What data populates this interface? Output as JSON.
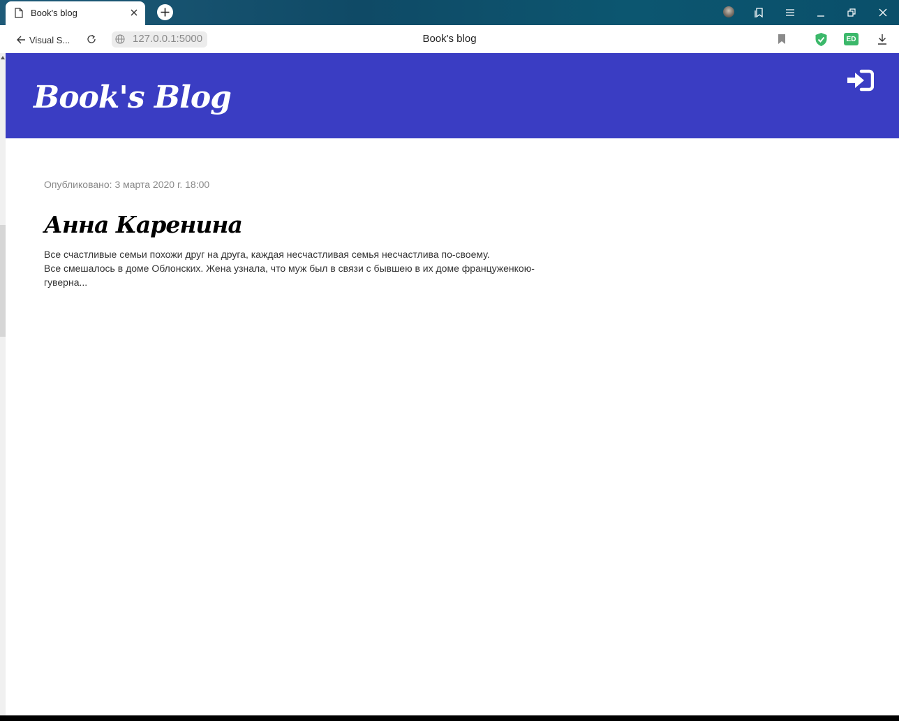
{
  "browser": {
    "tab": {
      "title": "Book's blog"
    },
    "nav": {
      "back_label": "Visual S..."
    },
    "address": {
      "url": "127.0.0.1:5000"
    },
    "page_title": "Book's blog",
    "extension_badge": "ED",
    "colors": {
      "titlebar": "#0f4a66",
      "shield": "#3bb86a"
    }
  },
  "site": {
    "logo": "Book's Blog",
    "header_color": "#3a3dc3"
  },
  "post": {
    "date": "Опубликовано: 3 марта 2020 г. 18:00",
    "title": "Анна Каренина",
    "lines": [
      "Все счастливые семьи похожи друг на друга, каждая несчастливая семья несчастлива по-своему.",
      "Все смешалось в доме Облонских. Жена узнала, что муж был в связи с бывшею в их доме француженкою-гуверна..."
    ]
  }
}
